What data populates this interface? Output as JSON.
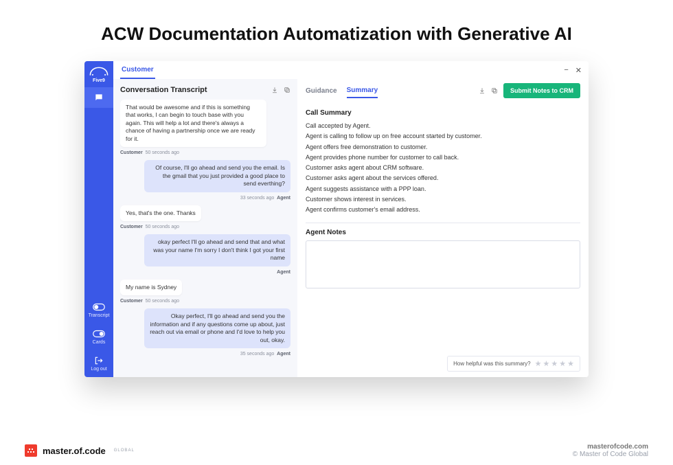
{
  "title": "ACW Documentation Automatization with Generative AI",
  "logo_text": "Five9",
  "sidebar": {
    "transcript": "Transcript",
    "cards": "Cards",
    "logout": "Log out"
  },
  "topbar": {
    "tab": "Customer"
  },
  "transcript": {
    "heading": "Conversation Transcript",
    "messages": [
      {
        "role": "cust",
        "text": "That would be awesome and if this is something that works, I can begin to touch base with you again. This will help a lot and there's always a chance of having a partnership once we are ready for it.",
        "who": "Customer",
        "time": "50 seconds ago"
      },
      {
        "role": "agent",
        "text": "Of course, I'll go ahead and send you the email. Is the gmail that you just provided a good place to send everthing?",
        "who": "Agent",
        "time": "33 seconds ago"
      },
      {
        "role": "cust",
        "text": "Yes, that's the one. Thanks",
        "who": "Customer",
        "time": "50 seconds ago"
      },
      {
        "role": "agent",
        "text": "okay perfect I'll go ahead and send that and what was your name I'm sorry I don't think I got your first name",
        "who": "Agent",
        "time": ""
      },
      {
        "role": "cust",
        "text": "My name is Sydney",
        "who": "Customer",
        "time": "50 seconds ago"
      },
      {
        "role": "agent",
        "text": "Okay perfect, I'll go ahead and send you the information and if any questions come up about, just reach out via email or phone and I'd love to help you out, okay.",
        "who": "Agent",
        "time": "35 seconds ago"
      }
    ]
  },
  "right": {
    "tabs": {
      "guidance": "Guidance",
      "summary": "Summary"
    },
    "submit": "Submit Notes to CRM",
    "call_summary_title": "Call Summary",
    "summary_lines": [
      "Call accepted by Agent.",
      "Agent is calling to follow up on free account started by customer.",
      "Agent offers free demonstration to customer.",
      "Agent provides phone number for customer to call back.",
      "Customer asks agent about CRM software.",
      "Customer asks agent about the services offered.",
      "Agent suggests assistance with a PPP loan.",
      "Customer shows interest in services.",
      "Agent confirms customer's email address."
    ],
    "notes_title": "Agent Notes",
    "rating_q": "How helpful was this summary?"
  },
  "footer": {
    "brand": "master.of.code",
    "brand_sub": "GLOBAL",
    "domain": "masterofcode.com",
    "copyright": "© Master of Code Global"
  }
}
